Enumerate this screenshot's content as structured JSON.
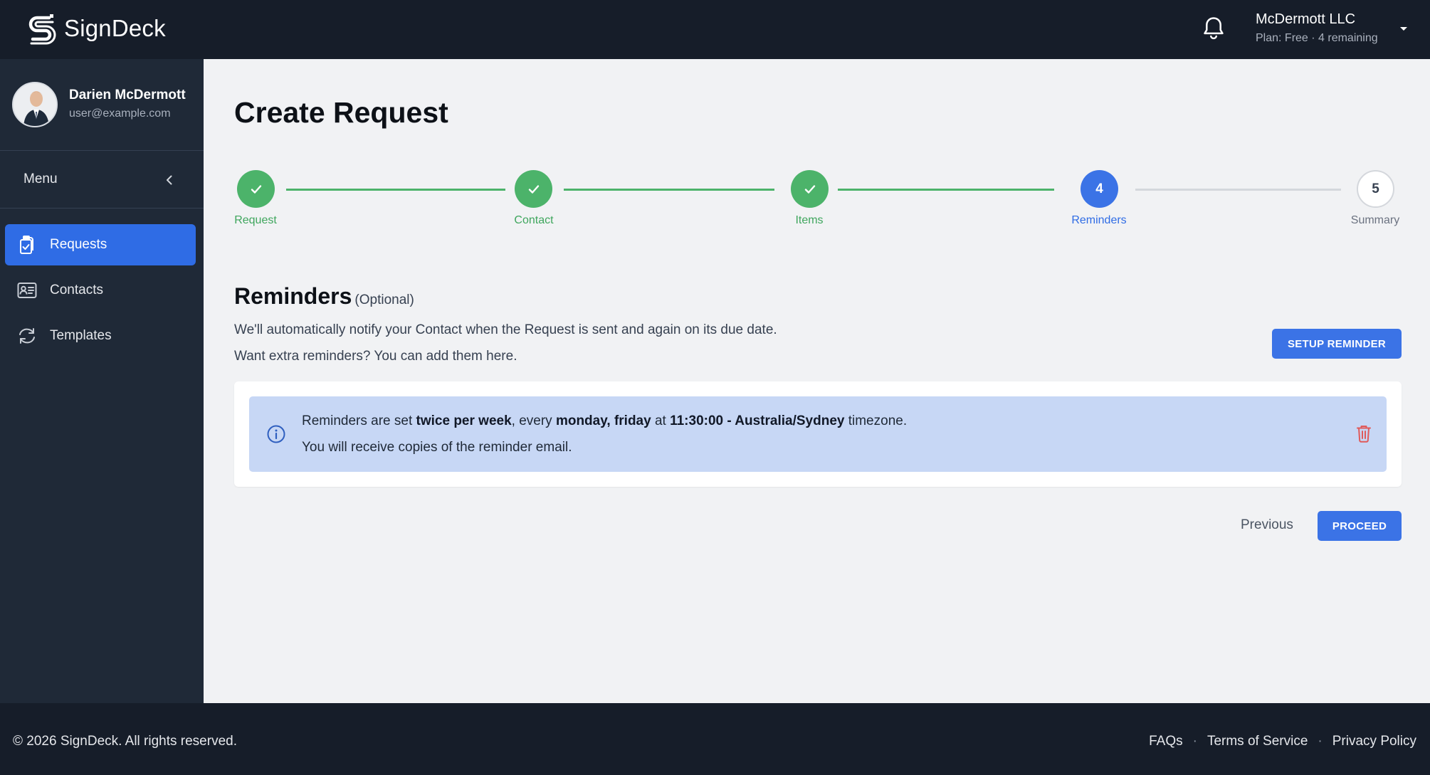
{
  "header": {
    "logo_text": "SignDeck",
    "org_name": "McDermott LLC",
    "org_plan": "Plan: Free · 4 remaining"
  },
  "sidebar": {
    "profile": {
      "name": "Darien McDermott",
      "email": "user@example.com"
    },
    "menu_label": "Menu",
    "items": [
      {
        "label": "Requests",
        "icon": "clipboard-icon",
        "active": true
      },
      {
        "label": "Contacts",
        "icon": "contact-card-icon",
        "active": false
      },
      {
        "label": "Templates",
        "icon": "refresh-icon",
        "active": false
      }
    ]
  },
  "main": {
    "title": "Create Request",
    "steps": [
      {
        "label": "Request",
        "state": "done"
      },
      {
        "label": "Contact",
        "state": "done"
      },
      {
        "label": "Items",
        "state": "done"
      },
      {
        "label": "Reminders",
        "state": "current",
        "number": "4"
      },
      {
        "label": "Summary",
        "state": "todo",
        "number": "5"
      }
    ],
    "section": {
      "title": "Reminders",
      "optional": "(Optional)",
      "desc1": "We'll automatically notify your Contact when the Request is sent and again on its due date.",
      "desc2": "Want extra reminders? You can add them here.",
      "setup_button": "SETUP REMINDER"
    },
    "alert": {
      "prefix": "Reminders are set ",
      "frequency": "twice per week",
      "mid1": ", every ",
      "days": "monday, friday",
      "mid2": " at ",
      "time_zone": "11:30:00 - Australia/Sydney",
      "suffix": " timezone.",
      "line2": "You will receive copies of the reminder email."
    },
    "previous_button": "Previous",
    "proceed_button": "PROCEED"
  },
  "footer": {
    "copyright": "© 2026 SignDeck. All rights reserved.",
    "links": [
      "FAQs",
      "Terms of Service",
      "Privacy Policy"
    ],
    "separator": "·"
  },
  "colors": {
    "primary": "#3b73e6",
    "success": "#4cb36a",
    "dark": "#161d29",
    "sidebar": "#1f2937",
    "alert_bg": "#c7d7f5",
    "danger": "#e05a5a"
  }
}
